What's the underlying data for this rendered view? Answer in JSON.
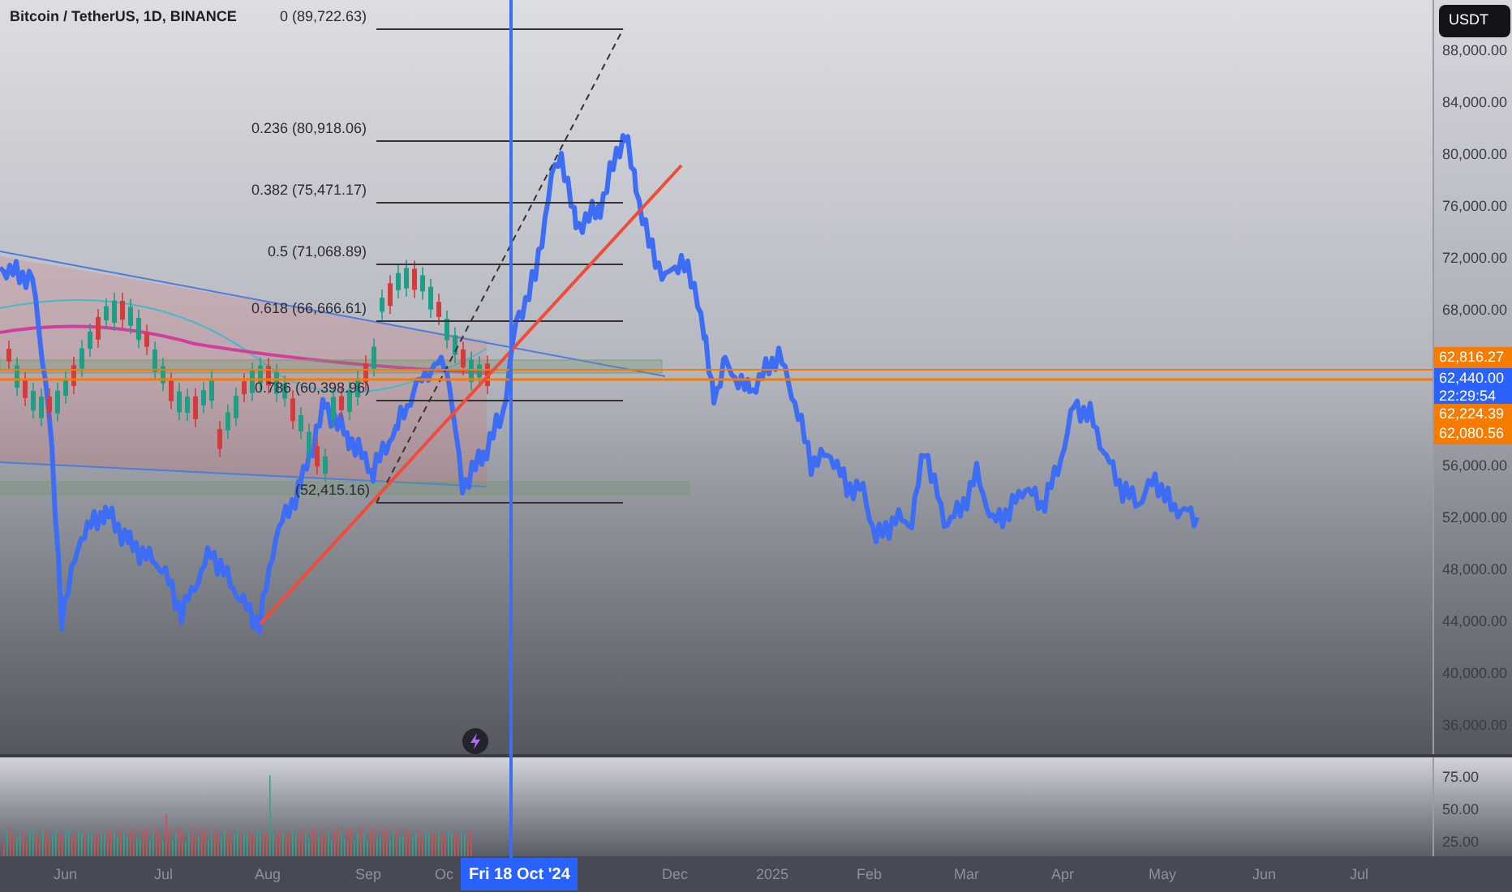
{
  "chart": {
    "title": "Bitcoin / TetherUS, 1D, BINANCE",
    "fib_levels": [
      {
        "label": "0 (89,722.63)"
      },
      {
        "label": "0.236 (80,918.06)"
      },
      {
        "label": "0.382 (75,471.17)"
      },
      {
        "label": "0.5 (71,068.89)"
      },
      {
        "label": "0.618 (66,666.61)"
      },
      {
        "label": "0.786 (60,398.96)"
      },
      {
        "label": "(52,415.16)"
      }
    ],
    "currency": "USDT",
    "price_axis": [
      "88,000.00",
      "84,000.00",
      "80,000.00",
      "76,000.00",
      "72,000.00",
      "68,000.00",
      "56,000.00",
      "52,000.00",
      "48,000.00",
      "44,000.00",
      "40,000.00",
      "36,000.00"
    ],
    "price_tags": [
      {
        "price": "62,816.27",
        "color": "#f57c00"
      },
      {
        "price": "62,440.00",
        "countdown": "22:29:54",
        "color": "#2962ff"
      },
      {
        "price": "62,224.39",
        "color": "#f57c00"
      },
      {
        "price": "62,080.56",
        "color": "#f57c00"
      }
    ]
  },
  "volume_axis": [
    "75.00",
    "50.00",
    "25.00"
  ],
  "time_axis": [
    "Jun",
    "Jul",
    "Aug",
    "Sep",
    "Oc",
    "Dec",
    "2025",
    "Feb",
    "Mar",
    "Apr",
    "May",
    "Jun",
    "Jul"
  ],
  "crosshair_date": "Fri 18 Oct '24"
}
